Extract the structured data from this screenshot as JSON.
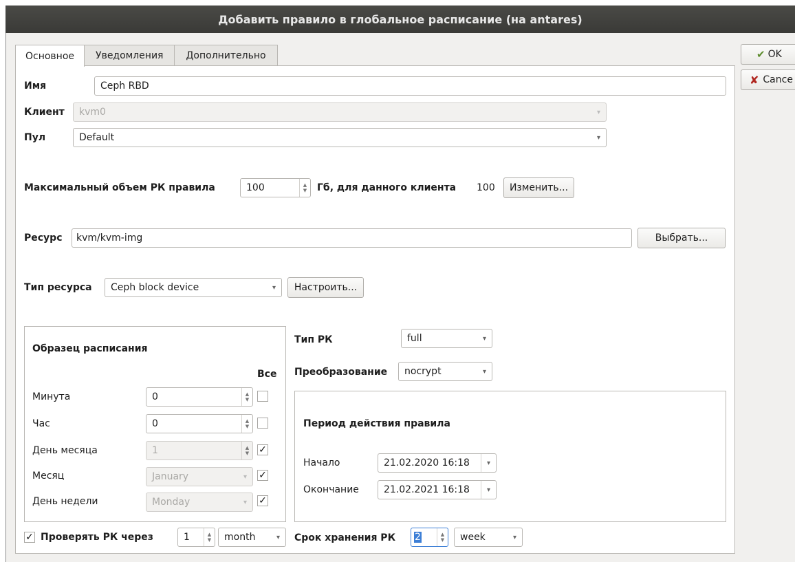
{
  "window": {
    "title": "Добавить правило в глобальное расписание (на antares)"
  },
  "tabs": [
    "Основное",
    "Уведомления",
    "Дополнительно"
  ],
  "buttons": {
    "ok": "OK",
    "cancel": "Cance",
    "change": "Изменить...",
    "choose": "Выбрать...",
    "configure": "Настроить..."
  },
  "form": {
    "name_label": "Имя",
    "name_value": "Ceph RBD",
    "client_label": "Клиент",
    "client_value": "kvm0",
    "pool_label": "Пул",
    "pool_value": "Default",
    "max_label": "Максимальный объем РК правила",
    "max_value": "100",
    "max_suffix": "Гб, для данного клиента",
    "max_client_value": "100",
    "resource_label": "Ресурс",
    "resource_value": "kvm/kvm-img",
    "resource_type_label": "Тип ресурса",
    "resource_type_value": "Ceph block device"
  },
  "schedule": {
    "title": "Образец расписания",
    "all_label": "Все",
    "rows": [
      {
        "label": "Минута",
        "value": "0",
        "all": false,
        "disabled": false
      },
      {
        "label": "Час",
        "value": "0",
        "all": false,
        "disabled": false
      },
      {
        "label": "День месяца",
        "value": "1",
        "all": true,
        "disabled": true
      },
      {
        "label": "Месяц",
        "value": "January",
        "all": true,
        "disabled": true
      },
      {
        "label": "День недели",
        "value": "Monday",
        "all": true,
        "disabled": true
      }
    ]
  },
  "backup": {
    "type_label": "Тип РК",
    "type_value": "full",
    "transform_label": "Преобразование",
    "transform_value": "nocrypt"
  },
  "period": {
    "title": "Период действия правила",
    "start_label": "Начало",
    "start_value": "21.02.2020 16:18",
    "end_label": "Окончание",
    "end_value": "21.02.2021 16:18"
  },
  "verify": {
    "label": "Проверять РК через",
    "checked": true,
    "value": "1",
    "unit": "month"
  },
  "retention": {
    "label": "Срок хранения РК",
    "value": "2",
    "unit": "week"
  },
  "icons": {
    "ok": "checkmark-arrow-icon",
    "cancel": "x-icon"
  },
  "colors": {
    "titlebar": "#3e3e3b",
    "selection": "#3d7fd6",
    "cancel_icon": "#b0261f",
    "ok_icon": "#5a8a2a"
  }
}
